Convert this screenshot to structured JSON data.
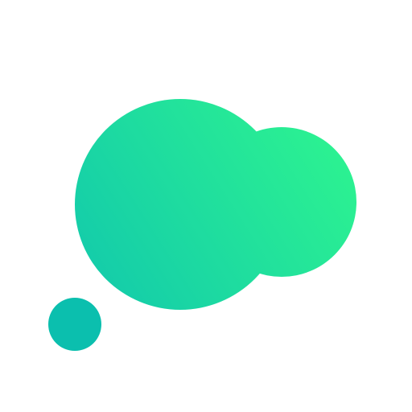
{
  "logo": {
    "icon_name": "thought-bubble-icon",
    "background_color": "#ffffff",
    "gradient": {
      "start_color": "#0ec3b0",
      "end_color": "#2ef58f"
    },
    "small_dot_color": "#0bbfae"
  }
}
